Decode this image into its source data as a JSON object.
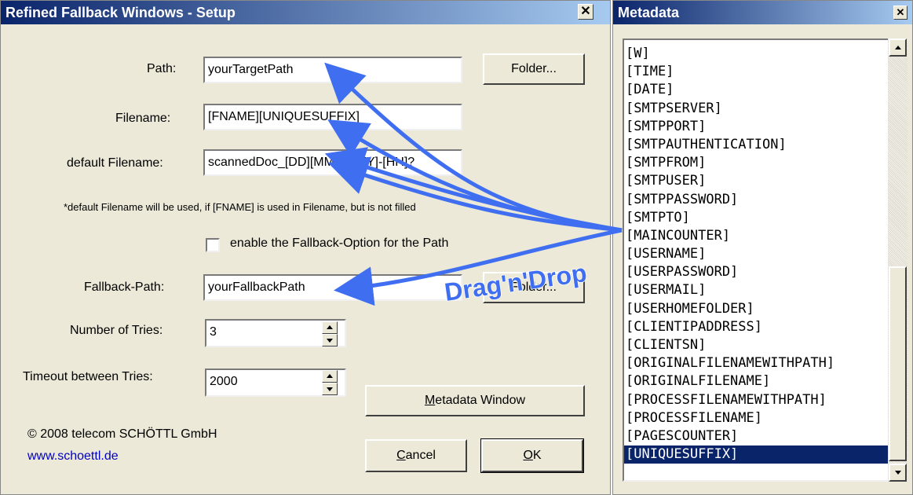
{
  "setup_window": {
    "title": "Refined Fallback Windows - Setup",
    "close_glyph": "✕",
    "path_label": "Path:",
    "path_value": "yourTargetPath",
    "folder_button": "Folder...",
    "filename_label": "Filename:",
    "filename_value": "[FNAME][UNIQUESUFFIX]",
    "default_filename_label": "default Filename:",
    "default_filename_value": "scannedDoc_[DD][MM][YYYY]-[HH]?",
    "note": "*default Filename will be used, if [FNAME] is used in Filename, but is not filled",
    "fallback_checkbox_label": "enable the Fallback-Option for the Path",
    "fallback_checked": false,
    "fallback_path_label": "Fallback-Path:",
    "fallback_path_value": "yourFallbackPath",
    "fallback_folder_button": "Folder...",
    "tries_label": "Number of Tries:",
    "tries_value": "3",
    "timeout_label": "Timeout between Tries:",
    "timeout_value": "2000",
    "metadata_button_prefix": "M",
    "metadata_button_rest": "etadata Window",
    "copyright": "© 2008 telecom SCHÖTTL GmbH",
    "website": "www.schoettl.de",
    "cancel_prefix": "C",
    "cancel_rest": "ancel",
    "ok_prefix": "O",
    "ok_rest": "K"
  },
  "metadata_window": {
    "title": "Metadata",
    "close_glyph": "✕",
    "items": [
      "[W]",
      "[TIME]",
      "[DATE]",
      "[SMTPSERVER]",
      "[SMTPPORT]",
      "[SMTPAUTHENTICATION]",
      "[SMTPFROM]",
      "[SMTPUSER]",
      "[SMTPPASSWORD]",
      "[SMTPTO]",
      "[MAINCOUNTER]",
      "[USERNAME]",
      "[USERPASSWORD]",
      "[USERMAIL]",
      "[USERHOMEFOLDER]",
      "[CLIENTIPADDRESS]",
      "[CLIENTSN]",
      "[ORIGINALFILENAMEWITHPATH]",
      "[ORIGINALFILENAME]",
      "[PROCESSFILENAMEWITHPATH]",
      "[PROCESSFILENAME]",
      "[PAGESCOUNTER]",
      "[UNIQUESUFFIX]"
    ],
    "selected_index": 22
  },
  "annotation": {
    "text": "Drag'n'Drop"
  },
  "colors": {
    "titlebar_start": "#0a246a",
    "titlebar_end": "#a6caf0",
    "arrow": "#3f6ff0",
    "link": "#0000c0"
  }
}
